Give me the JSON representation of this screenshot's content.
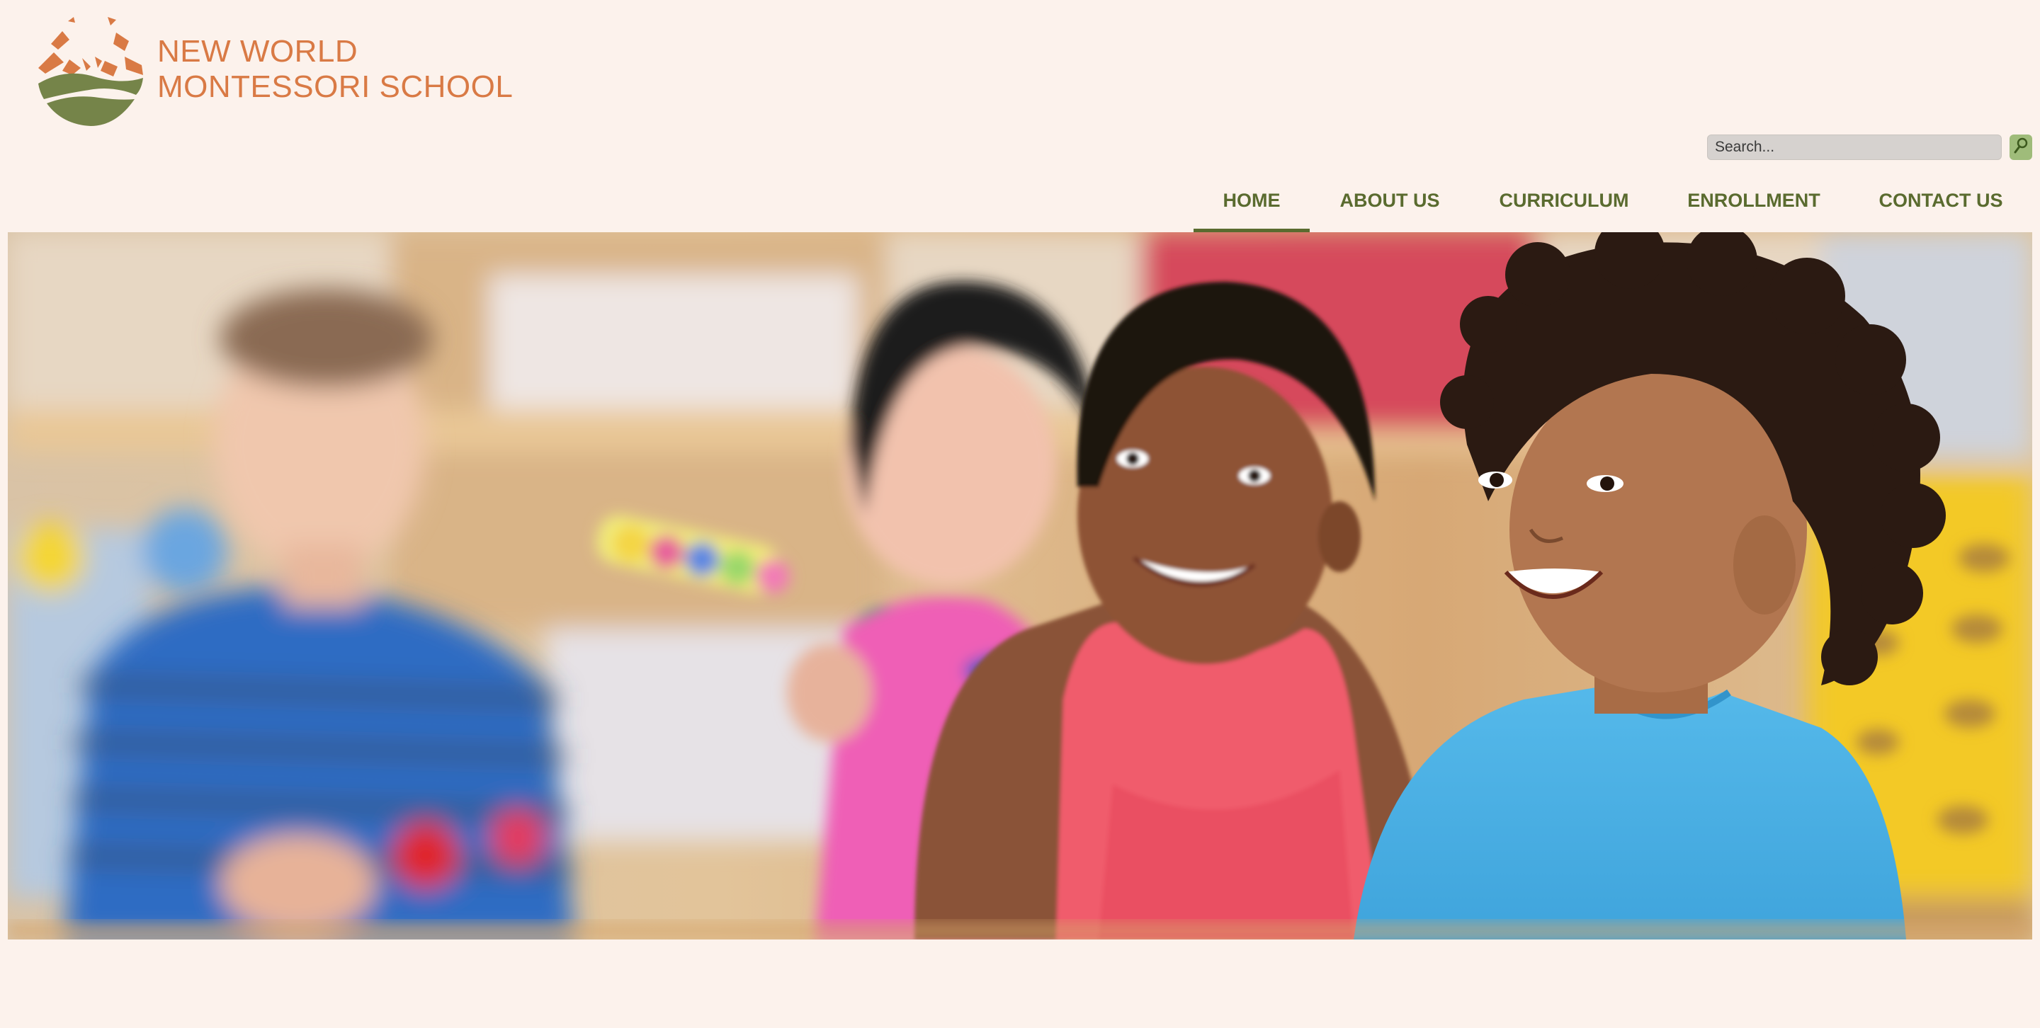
{
  "brand": {
    "line1": "NEW WORLD",
    "line2": "MONTESSORI SCHOOL",
    "color": "#d97a45",
    "logo": "sun-over-hills-logo"
  },
  "search": {
    "placeholder": "Search...",
    "button_icon": "magnifier-icon"
  },
  "nav": {
    "items": [
      {
        "label": "HOME",
        "active": true
      },
      {
        "label": "ABOUT US",
        "active": false
      },
      {
        "label": "CURRICULUM",
        "active": false
      },
      {
        "label": "ENROLLMENT",
        "active": false
      },
      {
        "label": "CONTACT US",
        "active": false
      }
    ],
    "color": "#5a6b2f"
  },
  "colors": {
    "background": "#fcf2ec",
    "accent_green": "#5a6b2f",
    "accent_orange": "#d97a45"
  }
}
